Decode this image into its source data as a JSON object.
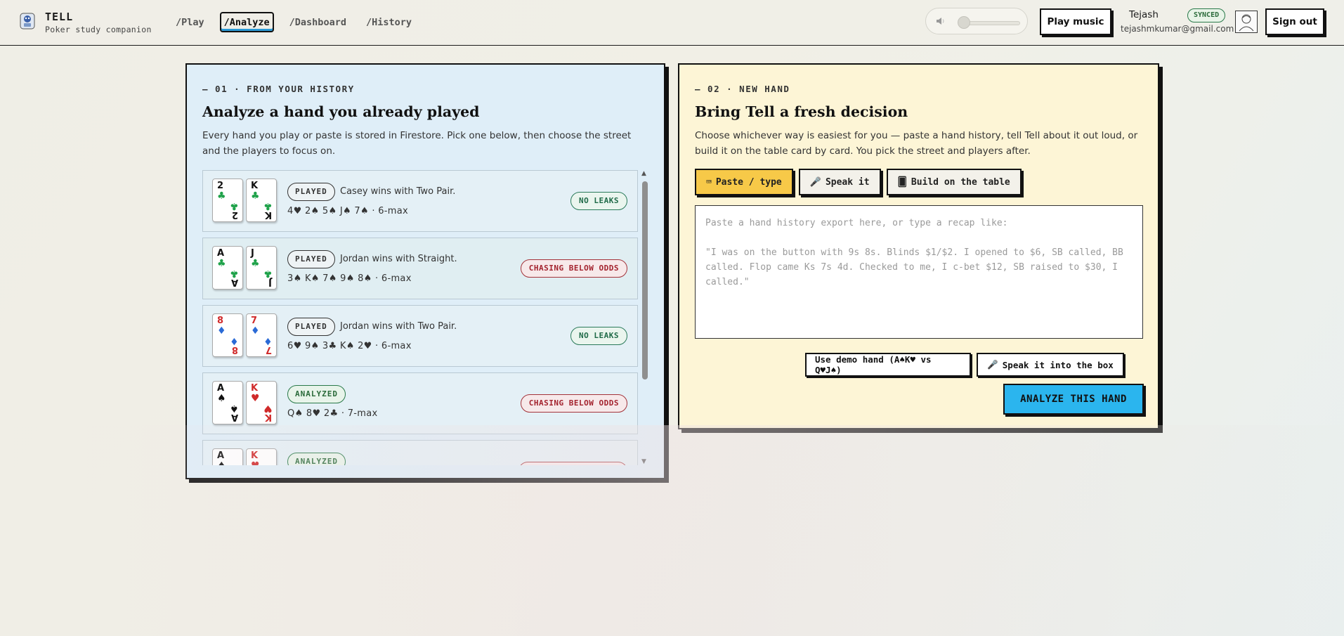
{
  "app": {
    "name": "TELL",
    "tagline": "Poker study companion"
  },
  "nav": [
    {
      "label": "/Play",
      "active": false
    },
    {
      "label": "/Analyze",
      "active": true
    },
    {
      "label": "/Dashboard",
      "active": false
    },
    {
      "label": "/History",
      "active": false
    }
  ],
  "header": {
    "volume_icon": "speaker-icon",
    "play_music_label": "Play music",
    "user_name": "Tejash",
    "sync_status": "SYNCED",
    "user_email": "tejashmkumar@gmail.com",
    "sign_out_label": "Sign out"
  },
  "history_panel": {
    "eyebrow": "— 01 · FROM YOUR HISTORY",
    "title": "Analyze a hand you already played",
    "description": "Every hand you play or paste is stored in Firestore. Pick one below, then choose the street and the players to focus on.",
    "hands": [
      {
        "cards": [
          {
            "rank": "2",
            "suit": "♣",
            "color": "green"
          },
          {
            "rank": "K",
            "suit": "♣",
            "color": "green"
          }
        ],
        "status": "PLAYED",
        "winner": "Casey wins with Two Pair.",
        "board": "4♥ 2♠ 5♠ J♠ 7♠ · 6-max",
        "leak": "NO LEAKS",
        "leak_type": "good"
      },
      {
        "cards": [
          {
            "rank": "A",
            "suit": "♣",
            "color": "green"
          },
          {
            "rank": "J",
            "suit": "♣",
            "color": "green"
          }
        ],
        "status": "PLAYED",
        "winner": "Jordan wins with Straight.",
        "board": "3♠ K♠ 7♠ 9♠ 8♠ · 6-max",
        "leak": "CHASING BELOW ODDS",
        "leak_type": "bad"
      },
      {
        "cards": [
          {
            "rank": "8",
            "suit": "♦",
            "color": "blue"
          },
          {
            "rank": "7",
            "suit": "♦",
            "color": "blue"
          }
        ],
        "status": "PLAYED",
        "winner": "Jordan wins with Two Pair.",
        "board": "6♥ 9♠ 3♣ K♠ 2♥ · 6-max",
        "leak": "NO LEAKS",
        "leak_type": "good"
      },
      {
        "cards": [
          {
            "rank": "A",
            "suit": "♠",
            "color": "black"
          },
          {
            "rank": "K",
            "suit": "♥",
            "color": "red"
          }
        ],
        "status": "ANALYZED",
        "winner": "",
        "board": "Q♠ 8♥ 2♣ · 7-max",
        "leak": "CHASING BELOW ODDS",
        "leak_type": "bad"
      },
      {
        "cards": [
          {
            "rank": "A",
            "suit": "♠",
            "color": "black"
          },
          {
            "rank": "K",
            "suit": "♥",
            "color": "red"
          }
        ],
        "status": "ANALYZED",
        "winner": "",
        "board": "",
        "leak": "",
        "leak_type": "bad"
      }
    ]
  },
  "new_hand_panel": {
    "eyebrow": "— 02 · NEW HAND",
    "title": "Bring Tell a fresh decision",
    "description": "Choose whichever way is easiest for you — paste a hand history, tell Tell about it out loud, or build it on the table card by card. You pick the street and players after.",
    "tabs": [
      {
        "icon": "keyboard-icon",
        "glyph": "⌨",
        "label": "Paste / type",
        "active": true
      },
      {
        "icon": "microphone-icon",
        "glyph": "🎤",
        "label": "Speak it",
        "active": false
      },
      {
        "icon": "card-icon",
        "glyph": "🂠",
        "label": "Build on the table",
        "active": false
      }
    ],
    "input_value": "",
    "input_placeholder": "Paste a hand history export here, or type a recap like:\n\n\"I was on the button with 9s 8s. Blinds $1/$2. I opened to $6, SB called, BB called. Flop came Ks 7s 4d. Checked to me, I c-bet $12, SB raised to $30, I called.\"",
    "demo_label": "Use demo hand (A♠K♥ vs Q♥J♠)",
    "speak_label": "Speak it into the box",
    "analyze_label": "ANALYZE THIS HAND"
  }
}
